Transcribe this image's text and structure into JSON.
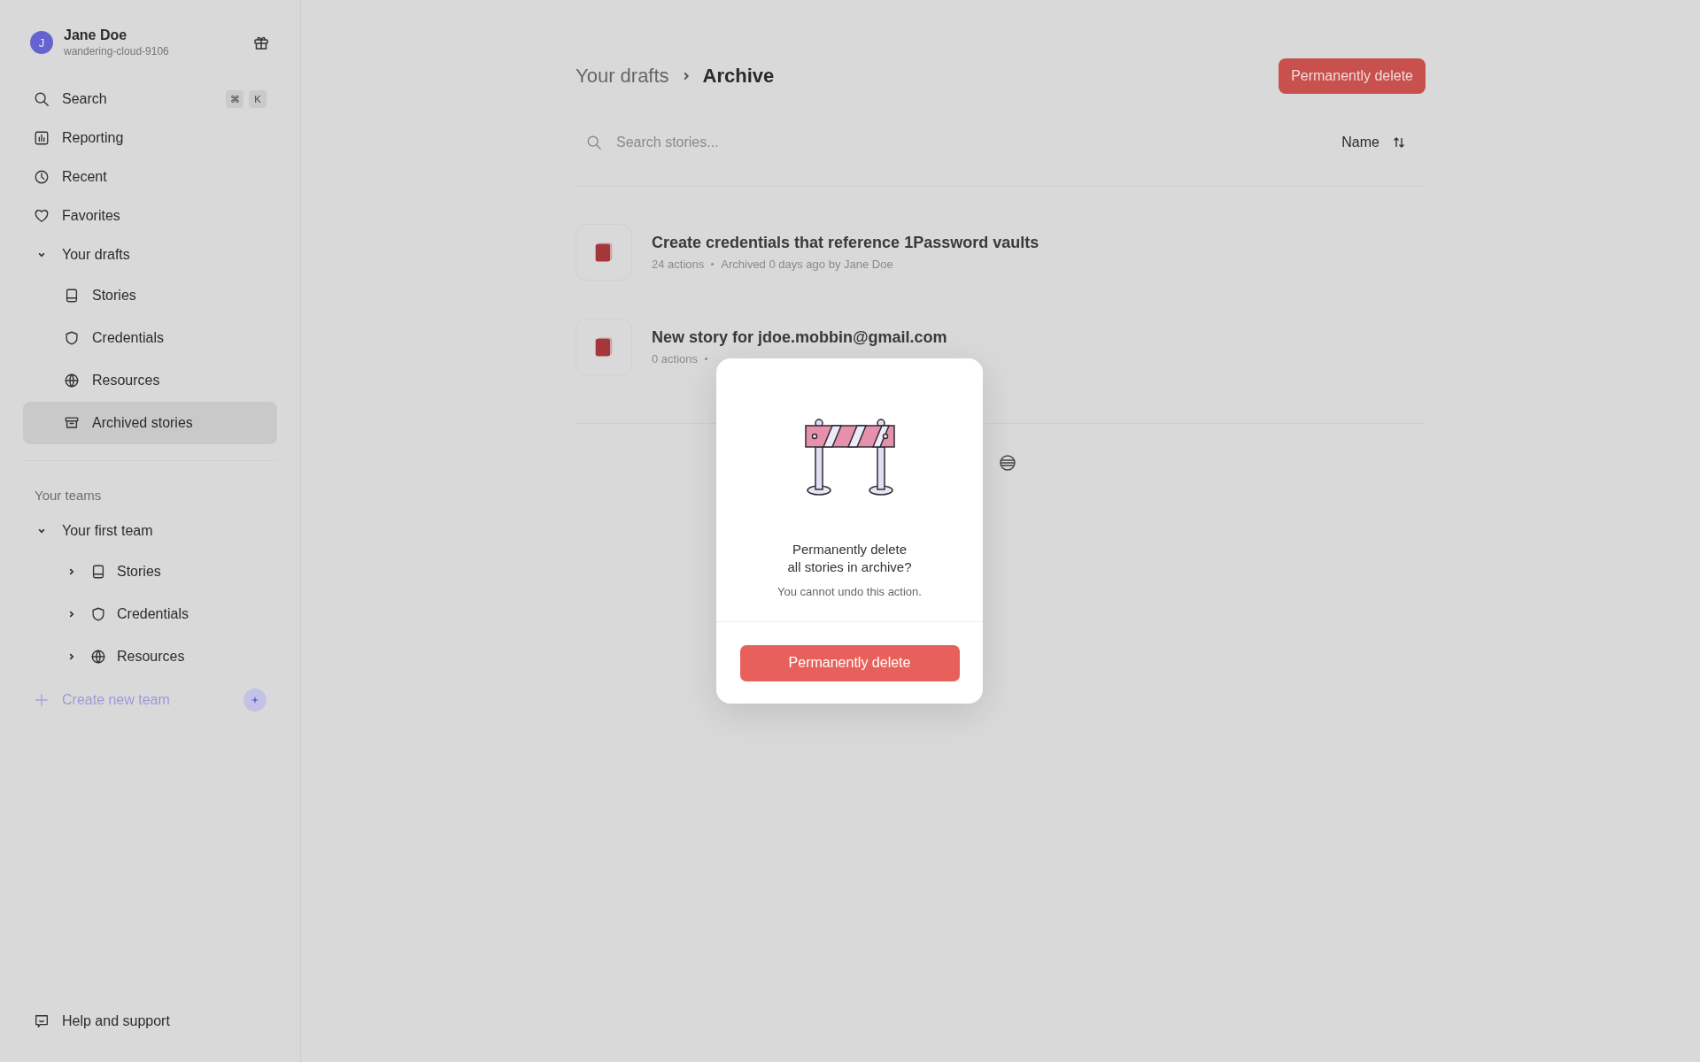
{
  "user": {
    "initial": "J",
    "name": "Jane Doe",
    "handle": "wandering-cloud-9106"
  },
  "sidebar": {
    "items": [
      {
        "label": "Search",
        "selected": false,
        "shortcut": [
          "⌘",
          "K"
        ]
      },
      {
        "label": "Reporting",
        "selected": false
      },
      {
        "label": "Recent",
        "selected": false
      },
      {
        "label": "Favorites",
        "selected": false
      },
      {
        "label": "Your drafts",
        "selected": false,
        "expanded": true,
        "children": [
          {
            "label": "Stories",
            "selected": false
          },
          {
            "label": "Credentials",
            "selected": false
          },
          {
            "label": "Resources",
            "selected": false
          },
          {
            "label": "Archived stories",
            "selected": true
          }
        ]
      }
    ],
    "teams_heading": "Your teams",
    "teams": [
      {
        "label": "Your first team",
        "expanded": true,
        "children": [
          {
            "label": "Stories",
            "expanded": false
          },
          {
            "label": "Credentials",
            "expanded": false
          },
          {
            "label": "Resources",
            "expanded": false
          }
        ]
      }
    ],
    "create_team": "Create new team",
    "help": "Help and support"
  },
  "breadcrumb": [
    "Your drafts",
    "Archive"
  ],
  "delete_button": "Permanently delete",
  "search": {
    "placeholder": "Search stories..."
  },
  "sort": {
    "label": "Name"
  },
  "stories": [
    {
      "title": "Create credentials that reference 1Password vaults",
      "actions": "24 actions",
      "archived": "Archived 0 days ago by Jane Doe"
    },
    {
      "title": "New story for jdoe.mobbin@gmail.com",
      "actions": "0 actions"
    }
  ],
  "dialog": {
    "title": "Permanently delete\nall stories in archive?",
    "message": "You cannot undo this action.",
    "button": "Permanently delete"
  }
}
